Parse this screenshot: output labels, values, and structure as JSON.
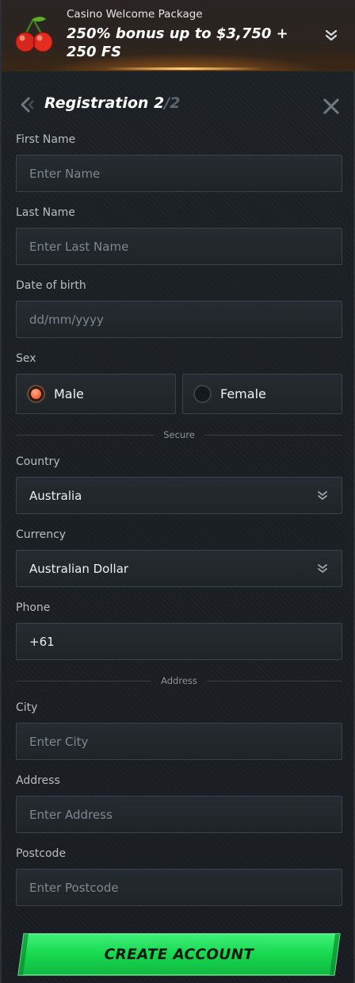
{
  "banner": {
    "subtitle": "Casino Welcome Package",
    "title": "250% bonus up to $3,750 + 250 FS"
  },
  "header": {
    "title": "Registration 2",
    "step_separator": "/",
    "step_total": "2"
  },
  "form": {
    "first_name": {
      "label": "First Name",
      "placeholder": "Enter Name"
    },
    "last_name": {
      "label": "Last Name",
      "placeholder": "Enter Last Name"
    },
    "dob": {
      "label": "Date of birth",
      "placeholder": "dd/mm/yyyy"
    },
    "sex": {
      "label": "Sex",
      "options": [
        "Male",
        "Female"
      ],
      "selected": "Male"
    },
    "secure_divider": "Secure",
    "country": {
      "label": "Country",
      "value": "Australia"
    },
    "currency": {
      "label": "Currency",
      "value": "Australian Dollar"
    },
    "phone": {
      "label": "Phone",
      "value": "+61"
    },
    "address_divider": "Address",
    "city": {
      "label": "City",
      "placeholder": "Enter City"
    },
    "address": {
      "label": "Address",
      "placeholder": "Enter Address"
    },
    "postcode": {
      "label": "Postcode",
      "placeholder": "Enter Postcode"
    }
  },
  "cta": {
    "label": "CREATE ACCOUNT"
  },
  "colors": {
    "accent_green": "#17d94f",
    "radio_selected": "#ff6a3a",
    "banner_glow": "#ffb347"
  },
  "icons": {
    "banner": "cherries-icon",
    "banner_toggle": "double-chevron-down-icon",
    "back": "back-arrow-icon",
    "close": "close-icon",
    "select": "chevron-down-icon"
  }
}
